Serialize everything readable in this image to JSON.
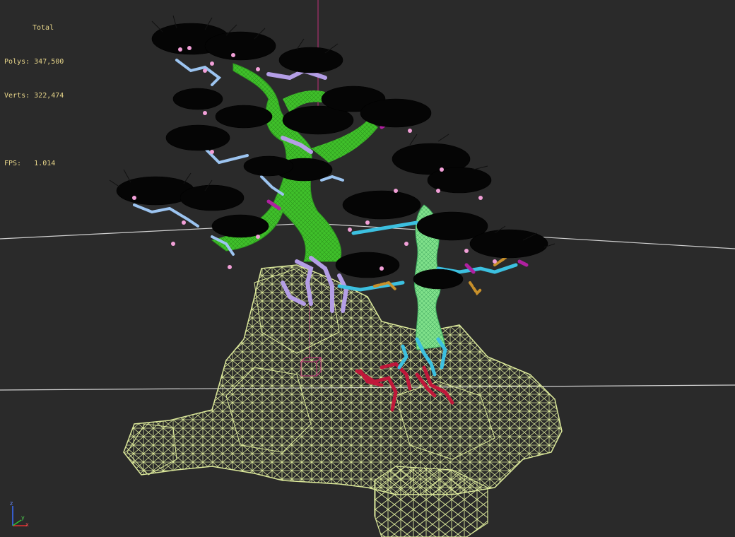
{
  "stats": {
    "total_label": "Total",
    "polys_label": "Polys:",
    "polys_value": "347,500",
    "verts_label": "Verts:",
    "verts_value": "322,474",
    "fps_label": "FPS:",
    "fps_value": "1.014"
  },
  "axis_gizmo": {
    "z_label": "z",
    "x_label": "x",
    "y_label": "y"
  },
  "colors": {
    "viewport_bg": "#2a2a2a",
    "stats_text": "#e8d68a",
    "rock_wire": "#dbe89a",
    "trunk_left": "#3fbf2a",
    "trunk_right": "#7fe08a",
    "branch_lavender": "#b49ee6",
    "branch_blue": "#9cc4f0",
    "branch_cyan": "#3cc0e0",
    "roots_red": "#c0183a",
    "blossom_pink": "#f2a0d8",
    "magenta": "#b020a0",
    "orange_twigs": "#c8902a",
    "needles": "#050505",
    "grid_line": "#d0d0d0",
    "pivot_line": "#c0307a"
  }
}
